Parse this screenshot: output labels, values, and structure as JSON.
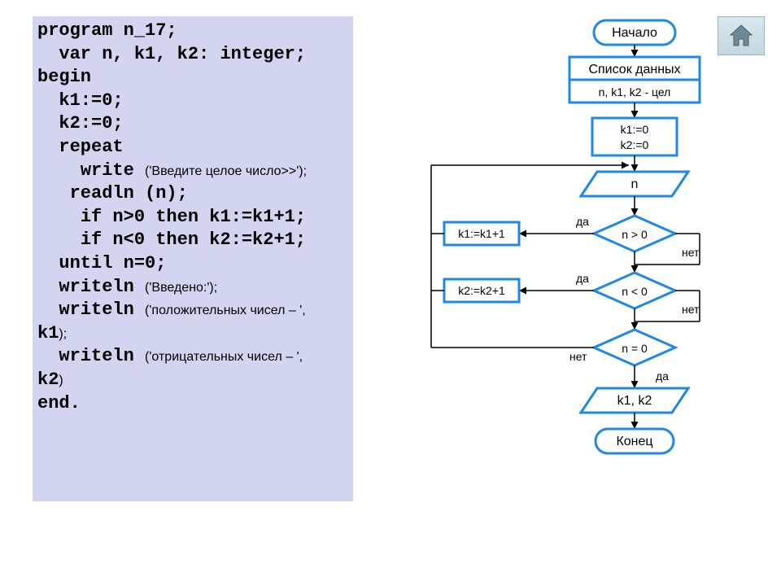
{
  "code": {
    "line1": "program n_17;",
    "line2_a": "var",
    "line2_b": " n, k1, k2: integer;",
    "line3": "begin",
    "line4": "k1:=0;",
    "line5": "k2:=0;",
    "line6": "repeat",
    "line7_a": "write ",
    "line7_b": "('Введите целое число>>');",
    "line8": "readln (n);",
    "line9_a": "if",
    "line9_b": " n>0 ",
    "line9_c": "then",
    "line9_d": " k1:=k1+1;",
    "line10_a": "if",
    "line10_b": " n<0 ",
    "line10_c": "then",
    "line10_d": " k2:=k2+1;",
    "line11_a": "until",
    "line11_b": " n=0;",
    "line12_a": "writeln ",
    "line12_b": "('Введено:');",
    "line13_a": "writeln ",
    "line13_b": "('положительных чисел – ', ",
    "line13_c": "k1",
    "line13_d": ");",
    "line14_a": "writeln ",
    "line14_b": "('отрицательных чисел – ', ",
    "line14_c": "k2",
    "line14_d": ")",
    "line15": "end."
  },
  "flow": {
    "start": "Начало",
    "data_header": "Список данных",
    "data_vars": "n, k1, k2 - цел",
    "init1": "k1:=0",
    "init2": "k2:=0",
    "input_n": "n",
    "cond1": "n > 0",
    "cond2": "n < 0",
    "cond3": "n = 0",
    "act1": "k1:=k1+1",
    "act2": "k2:=k2+1",
    "output": "k1, k2",
    "end": "Конец",
    "yes": "да",
    "no": "нет"
  }
}
